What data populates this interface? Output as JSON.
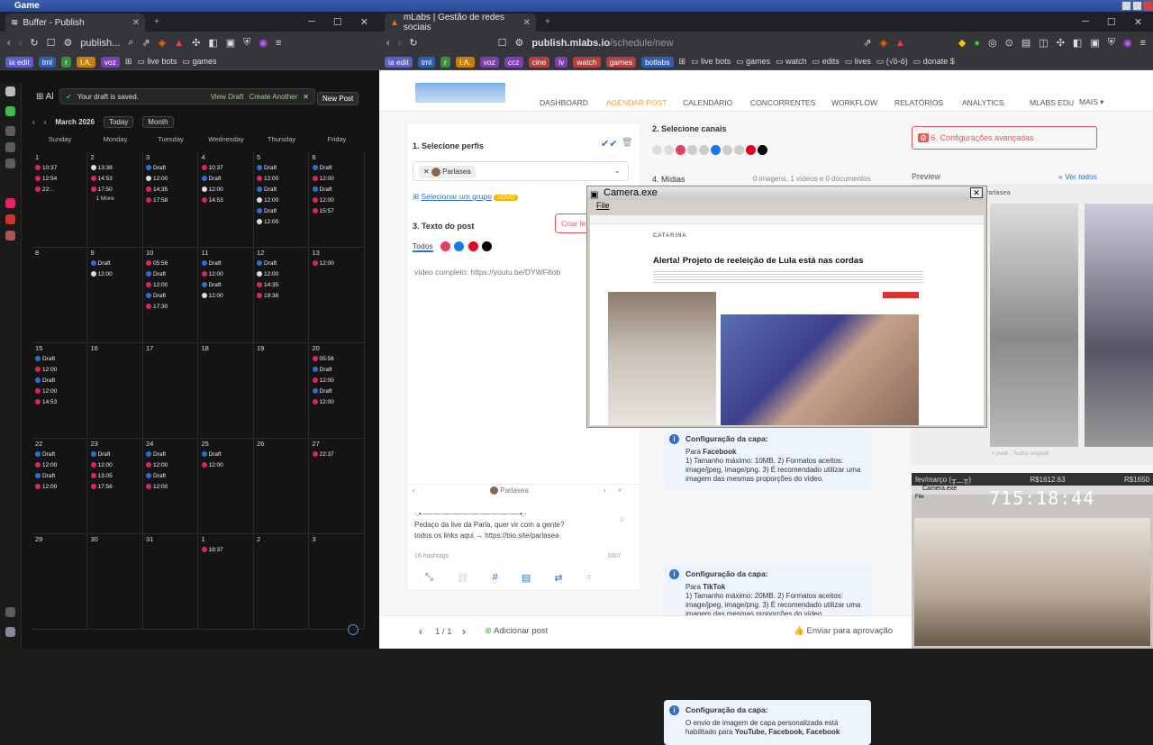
{
  "os": {
    "title": "Game"
  },
  "left_browser": {
    "tab_title": "Buffer - Publish",
    "url": "publish...",
    "bookmarks": [
      {
        "label": "ia edit",
        "style": ""
      },
      {
        "label": "tml",
        "style": "b"
      },
      {
        "label": "r",
        "style": "g"
      },
      {
        "label": "I.A.",
        "style": "o"
      },
      {
        "label": "voz",
        "style": "p"
      }
    ],
    "bookmark_folders": [
      "live bots",
      "games"
    ]
  },
  "buffer": {
    "toast_text": "Your draft is saved.",
    "toast_view": "View Draft",
    "toast_create": "Create Another",
    "new_post": "New Post",
    "month": "March 2026",
    "today": "Today",
    "view": "Month",
    "days": [
      "Sunday",
      "Monday",
      "Tuesday",
      "Wednesday",
      "Thursday",
      "Friday"
    ],
    "weeks": [
      [
        {
          "n": "1",
          "ev": [
            [
              "10:37",
              "d"
            ],
            [
              "12:54",
              "d"
            ],
            [
              "22:..",
              "d"
            ]
          ]
        },
        {
          "n": "2",
          "ev": [
            [
              "13:38",
              "w"
            ],
            [
              "14:53",
              "d"
            ],
            [
              "17:50",
              "d"
            ]
          ],
          "more": "1 More"
        },
        {
          "n": "3",
          "ev": [
            [
              "Draft",
              "b"
            ],
            [
              "12:00",
              "w"
            ],
            [
              "14:35",
              "d"
            ],
            [
              "17:58",
              "d"
            ]
          ]
        },
        {
          "n": "4",
          "ev": [
            [
              "10:37",
              "d"
            ],
            [
              "Draft",
              "b"
            ],
            [
              "12:00",
              "w"
            ],
            [
              "14:53",
              "d"
            ]
          ]
        },
        {
          "n": "5",
          "ev": [
            [
              "Draft",
              "b"
            ],
            [
              "12:00",
              "d"
            ],
            [
              "Draft",
              "b"
            ],
            [
              "12:00",
              "w"
            ],
            [
              "Draft",
              "b"
            ],
            [
              "12:00",
              "w"
            ]
          ]
        },
        {
          "n": "6",
          "ev": [
            [
              "Draft",
              "b"
            ],
            [
              "12:00",
              "d"
            ],
            [
              "Draft",
              "b"
            ],
            [
              "12:00",
              "d"
            ],
            [
              "15:57",
              "d"
            ]
          ]
        }
      ],
      [
        {
          "n": "8",
          "ev": []
        },
        {
          "n": "9",
          "ev": [
            [
              "Draft",
              "b"
            ],
            [
              "12:00",
              "w"
            ]
          ]
        },
        {
          "n": "10",
          "ev": [
            [
              "05:56",
              "d"
            ],
            [
              "Draft",
              "b"
            ],
            [
              "12:00",
              "d"
            ],
            [
              "Draft",
              "b"
            ],
            [
              "17:30",
              "d"
            ]
          ]
        },
        {
          "n": "11",
          "ev": [
            [
              "Draft",
              "b"
            ],
            [
              "12:00",
              "d"
            ],
            [
              "Draft",
              "b"
            ],
            [
              "12:00",
              "w"
            ]
          ]
        },
        {
          "n": "12",
          "ev": [
            [
              "Draft",
              "b"
            ],
            [
              "12:00",
              "w"
            ],
            [
              "14:35",
              "d"
            ],
            [
              "19:38",
              "d"
            ]
          ]
        },
        {
          "n": "13",
          "ev": [
            [
              "12:00",
              "d"
            ]
          ]
        }
      ],
      [
        {
          "n": "15",
          "ev": [
            [
              "Draft",
              "b"
            ],
            [
              "12:00",
              "d"
            ],
            [
              "Draft",
              "b"
            ],
            [
              "12:00",
              "d"
            ],
            [
              "14:53",
              "d"
            ]
          ]
        },
        {
          "n": "16",
          "ev": []
        },
        {
          "n": "17",
          "ev": []
        },
        {
          "n": "18",
          "ev": []
        },
        {
          "n": "19",
          "ev": []
        },
        {
          "n": "20",
          "ev": [
            [
              "05:56",
              "d"
            ],
            [
              "Draft",
              "b"
            ],
            [
              "12:00",
              "d"
            ],
            [
              "Draft",
              "b"
            ],
            [
              "12:00",
              "d"
            ]
          ]
        }
      ],
      [
        {
          "n": "22",
          "ev": [
            [
              "Draft",
              "b"
            ],
            [
              "12:00",
              "d"
            ],
            [
              "Draft",
              "b"
            ],
            [
              "12:00",
              "d"
            ]
          ]
        },
        {
          "n": "23",
          "ev": [
            [
              "Draft",
              "b"
            ],
            [
              "12:00",
              "d"
            ],
            [
              "13:05",
              "d"
            ],
            [
              "17:56",
              "d"
            ]
          ]
        },
        {
          "n": "24",
          "ev": [
            [
              "Draft",
              "b"
            ],
            [
              "12:00",
              "d"
            ],
            [
              "Draft",
              "b"
            ],
            [
              "12:00",
              "d"
            ]
          ]
        },
        {
          "n": "25",
          "ev": [
            [
              "Draft",
              "b"
            ],
            [
              "12:00",
              "d"
            ]
          ]
        },
        {
          "n": "26",
          "ev": []
        },
        {
          "n": "27",
          "ev": [
            [
              "22:37",
              "d"
            ]
          ]
        }
      ],
      [
        {
          "n": "29",
          "ev": []
        },
        {
          "n": "30",
          "ev": []
        },
        {
          "n": "31",
          "ev": []
        },
        {
          "n": "1",
          "ev": [
            [
              "18:37",
              "d"
            ]
          ]
        },
        {
          "n": "2",
          "ev": []
        },
        {
          "n": "3",
          "ev": []
        }
      ]
    ]
  },
  "right_browser": {
    "tab_title": "mLabs | Gestão de redes sociais",
    "url_host": "publish.mlabs.io",
    "url_path": "/schedule/new",
    "bookmarks": [
      {
        "label": "ia edit",
        "style": ""
      },
      {
        "label": "tml",
        "style": "b"
      },
      {
        "label": "r",
        "style": "g"
      },
      {
        "label": "I.A.",
        "style": "o"
      },
      {
        "label": "voz",
        "style": "p"
      },
      {
        "label": "ccz",
        "style": "p"
      },
      {
        "label": "cine",
        "style": "r"
      },
      {
        "label": "lv",
        "style": "p"
      },
      {
        "label": "watch",
        "style": "r"
      },
      {
        "label": "games",
        "style": "r"
      },
      {
        "label": "botlabs",
        "style": "b"
      }
    ],
    "bookmark_folders": [
      "live bots",
      "games",
      "watch",
      "edits",
      "lives",
      "(√ö-ö)",
      "donate $"
    ]
  },
  "mlabs": {
    "nav": [
      "DASHBOARD",
      "AGENDAR POST",
      "CALENDÁRIO",
      "CONCORRENTES",
      "WORKFLOW",
      "RELATÓRIOS",
      "ANALYTICS",
      "MLABS EDU",
      "MAIS ▾"
    ],
    "step1": "1. Selecione perfis",
    "profile": "Parlasea",
    "select_group": "Selecionar um grupo",
    "novo": "NOVO",
    "step2": "2. Selecione canais",
    "step3": "3. Texto do post",
    "criar": "Criar le",
    "todos": "Todos",
    "post_text": "vídeo completo: https://youtu.be/DYWF8ob",
    "step4": "4. Mídias",
    "midias_count": "0 imagens, 1 vídeos e 0 documentos",
    "adv": "6. Configurações avançadas",
    "preview": "Preview",
    "ver_todos": "« Ver todos",
    "preview_profile": "Parlasea",
    "caption1": "·.•·—·—·—·—·—·—·—·—·—·—·•.·",
    "caption2": "Pedaço da live da Parla, quer vir com a gente?",
    "caption3": "todos os links aqui → https://bio.site/parlasea",
    "hashtags": "16 hashtags",
    "char_count": "1807",
    "info1_title": "Configuração da capa:",
    "info1_for": "Para ",
    "info1_net": "Facebook",
    "info1_body": "1) Tamanho máximo: 10MB. 2) Formatos aceitos: image/jpeg, image/png. 3) É recomendado utilizar uma imagem das mesmas proporções do vídeo.",
    "info2_title": "Configuração da capa:",
    "info2_net": "TikTok",
    "info2_body": "1) Tamanho máximo: 20MB. 2) Formatos aceitos: image/jpeg, image/png. 3) É recomendado utilizar uma imagem das mesmas proporções do vídeo.",
    "info3_title": "Configuração da capa:",
    "info3_body": "O envio de imagem de capa personalizada está habilitado para",
    "info3_nets": "YouTube, Facebook, Facebook",
    "pager": "1 / 1",
    "add_post": "Adicionar post",
    "send_approval": "Enviar para aprovação",
    "audio": "• pseb · Áudio original",
    "parlasea_small": "Parlasea"
  },
  "camera": {
    "title": "Camera.exe",
    "menu": "File",
    "headline": "Alerta! Projeto de reeleição de Lula está nas cordas",
    "site": "CATARINA"
  },
  "stream": {
    "month": "fev/março (╥﹏╥)",
    "amount1": "R$1612.63",
    "amount2": "R$1650",
    "cam_title": "Camera.exe",
    "cam_menu": "File",
    "timer": "715:18:44"
  }
}
